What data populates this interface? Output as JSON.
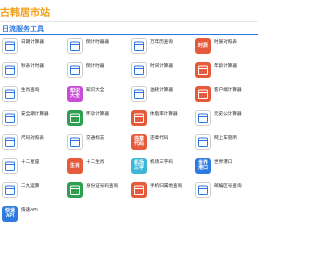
{
  "header": {
    "site_name": "古韩居市站"
  },
  "section": {
    "title": "日流服务工具"
  },
  "colors": {
    "accent": "#2d7be0",
    "brand": "#f39c12"
  },
  "tools": [
    {
      "name": "日期计算器",
      "desc": "",
      "icon": "calendar-icon",
      "badge": "",
      "color": "#ffffff",
      "outline": true
    },
    {
      "name": "倒计时器器",
      "desc": "",
      "icon": "stopwatch-icon",
      "badge": "",
      "color": "#ffffff",
      "outline": true
    },
    {
      "name": "万年历查询",
      "desc": "",
      "icon": "calendar-grid-icon",
      "badge": "",
      "color": "#ffffff",
      "outline": true
    },
    {
      "name": "时辰对照表",
      "desc": "",
      "icon": "time-badge-icon",
      "badge": "时辰",
      "color": "#e55a3c",
      "outline": false
    },
    {
      "name": "秒表计时器",
      "desc": "",
      "icon": "stopwatch-icon",
      "badge": "",
      "color": "#ffffff",
      "outline": true
    },
    {
      "name": "倒计时器",
      "desc": "",
      "icon": "alarm-clock-icon",
      "badge": "",
      "color": "#ffffff",
      "outline": true
    },
    {
      "name": "时间计算器",
      "desc": "",
      "icon": "clock-icon",
      "badge": "",
      "color": "#ffffff",
      "outline": true
    },
    {
      "name": "年龄计算器",
      "desc": "",
      "icon": "age-icon",
      "badge": "",
      "color": "#e55a3c",
      "outline": false
    },
    {
      "name": "生肖查询",
      "desc": "",
      "icon": "zodiac-icon",
      "badge": "",
      "color": "#ffffff",
      "outline": true
    },
    {
      "name": "知识大全",
      "desc": "",
      "icon": "knowledge-icon",
      "badge": "知识\n大全",
      "color": "#c94bd6",
      "outline": false
    },
    {
      "name": "油耗计算器",
      "desc": "",
      "icon": "car-icon",
      "badge": "",
      "color": "#ffffff",
      "outline": true
    },
    {
      "name": "客户端计算器",
      "desc": "",
      "icon": "client-icon",
      "badge": "",
      "color": "#e55a3c",
      "outline": false
    },
    {
      "name": "安全期计算器",
      "desc": "",
      "icon": "safety-icon",
      "badge": "",
      "color": "#ffffff",
      "outline": true
    },
    {
      "name": "怀孕计算器",
      "desc": "",
      "icon": "pregnancy-icon",
      "badge": "",
      "color": "#2e9e4f",
      "outline": false
    },
    {
      "name": "体脂率计算器",
      "desc": "",
      "icon": "body-icon",
      "badge": "",
      "color": "#e55a3c",
      "outline": false
    },
    {
      "name": "元史公计算器",
      "desc": "",
      "icon": "history-icon",
      "badge": "",
      "color": "#ffffff",
      "outline": true
    },
    {
      "name": "尺码对照表",
      "desc": "",
      "icon": "ruler-icon",
      "badge": "",
      "color": "#ffffff",
      "outline": true
    },
    {
      "name": "交通标志",
      "desc": "",
      "icon": "sign-icon",
      "badge": "",
      "color": "#ffffff",
      "outline": true
    },
    {
      "name": "违章代码",
      "desc": "",
      "icon": "code-icon",
      "badge": "违章\n代码",
      "color": "#e55a3c",
      "outline": false
    },
    {
      "name": "网上车管所",
      "desc": "",
      "icon": "vehicle-icon",
      "badge": "",
      "color": "#ffffff",
      "outline": true
    },
    {
      "name": "十二星座",
      "desc": "",
      "icon": "constellation-icon",
      "badge": "",
      "color": "#ffffff",
      "outline": true
    },
    {
      "name": "十二生肖",
      "desc": "",
      "icon": "zodiac-badge-icon",
      "badge": "生肖",
      "color": "#e55a3c",
      "outline": false
    },
    {
      "name": "机场三字码",
      "desc": "",
      "icon": "airport-icon",
      "badge": "机场\n三字",
      "color": "#3cb8d6",
      "outline": false
    },
    {
      "name": "世界港口",
      "desc": "",
      "icon": "port-icon",
      "badge": "世界\n港口",
      "color": "#2d7be0",
      "outline": false
    },
    {
      "name": "二九运算",
      "desc": "",
      "icon": "math-icon",
      "badge": "",
      "color": "#ffffff",
      "outline": true
    },
    {
      "name": "身份证号码查询",
      "desc": "",
      "icon": "id-icon",
      "badge": "",
      "color": "#2e9e4f",
      "outline": false
    },
    {
      "name": "手机归属地查询",
      "desc": "",
      "icon": "phone-icon",
      "badge": "",
      "color": "#e55a3c",
      "outline": false
    },
    {
      "name": "邮编区号查询",
      "desc": "",
      "icon": "post-icon",
      "badge": "",
      "color": "#ffffff",
      "outline": true
    },
    {
      "name": "快速API",
      "desc": "",
      "icon": "api-icon",
      "badge": "快速\nAPI",
      "color": "#2d7be0",
      "outline": false
    }
  ]
}
